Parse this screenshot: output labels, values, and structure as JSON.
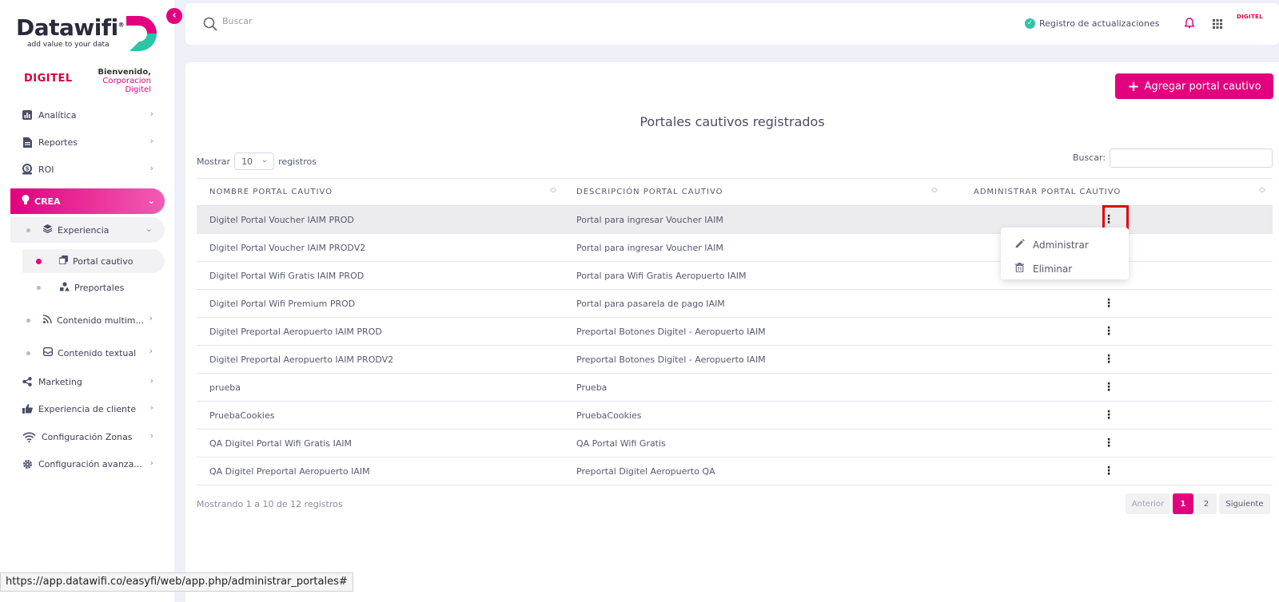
{
  "brand": {
    "logo_text": "Datawifi",
    "logo_reg": "®",
    "tagline": "add value to your data",
    "client_logo": "DIGITEL",
    "welcome": "Bienvenido,",
    "client_name_1": "Corporacion",
    "client_name_2": "Digitel",
    "collapse_glyph": "‹"
  },
  "sidebar": {
    "items": [
      {
        "label": "Analítica",
        "icon": "chart-icon"
      },
      {
        "label": "Reportes",
        "icon": "document-icon"
      },
      {
        "label": "ROI",
        "icon": "money-icon"
      }
    ],
    "active": {
      "label": "CREA",
      "icon": "bulb-icon"
    },
    "experiencia": {
      "label": "Experiencia"
    },
    "portal_cautivo": {
      "label": "Portal cautivo"
    },
    "preportales": {
      "label": "Preportales"
    },
    "contenido_multimedia": {
      "label": "Contenido multim..."
    },
    "contenido_textual": {
      "label": "Contenido textual"
    },
    "bottom_items": [
      {
        "label": "Marketing",
        "icon": "share-icon"
      },
      {
        "label": "Experiencia de cliente",
        "icon": "thumbs-up-icon"
      },
      {
        "label": "Configuración Zonas",
        "icon": "wifi-icon"
      },
      {
        "label": "Configuración avanza...",
        "icon": "gear-icon"
      }
    ]
  },
  "topbar": {
    "search_placeholder": "Buscar",
    "update_log": "Registro de actualizaciones",
    "mini_logo": "DIGITEL"
  },
  "main": {
    "add_button": "Agregar portal cautivo",
    "title": "Portales cautivos registrados",
    "show_prefix": "Mostrar",
    "show_value": "10",
    "show_suffix": "registros",
    "filter_label": "Buscar:",
    "columns": [
      "NOMBRE PORTAL CAUTIVO",
      "DESCRIPCIÓN PORTAL CAUTIVO",
      "ADMINISTRAR PORTAL CAUTIVO"
    ],
    "rows": [
      {
        "name": "Digitel Portal Voucher IAIM PROD",
        "desc": "Portal para ingresar Voucher IAIM"
      },
      {
        "name": "Digitel Portal Voucher IAIM PRODV2",
        "desc": "Portal para ingresar Voucher IAIM"
      },
      {
        "name": "Digitel Portal Wifi Gratis IAIM PROD",
        "desc": "Portal para Wifi Gratis Aeropuerto IAIM"
      },
      {
        "name": "Digitel Portal Wifi Premium PROD",
        "desc": "Portal para pasarela de pago IAIM"
      },
      {
        "name": "Digitel Preportal Aeropuerto IAIM PROD",
        "desc": "Preportal Botones Digitel - Aeropuerto IAIM"
      },
      {
        "name": "Digitel Preportal Aeropuerto IAIM PRODV2",
        "desc": "Preportal Botones Digitel - Aeropuerto IAIM"
      },
      {
        "name": "prueba",
        "desc": "Prueba"
      },
      {
        "name": "PruebaCookies",
        "desc": "PruebaCookies"
      },
      {
        "name": "QA Digitel Portal Wifi Gratis IAIM",
        "desc": "QA Portal Wifi Gratis"
      },
      {
        "name": "QA Digitel Preportal Aeropuerto IAIM",
        "desc": "Preportal Digitel Aeropuerto QA"
      }
    ],
    "dropdown": {
      "administrar": "Administrar",
      "eliminar": "Eliminar"
    },
    "info": "Mostrando 1 a 10 de 12 registros",
    "pager": {
      "prev": "Anterior",
      "p1": "1",
      "p2": "2",
      "next": "Siguiente"
    }
  },
  "statusbar": {
    "url": "https://app.datawifi.co/easyfi/web/app.php/administrar_portales#"
  },
  "colors": {
    "accent": "#e3007e",
    "digitel_red": "#d6003b",
    "check_green": "#2ec4a5"
  }
}
